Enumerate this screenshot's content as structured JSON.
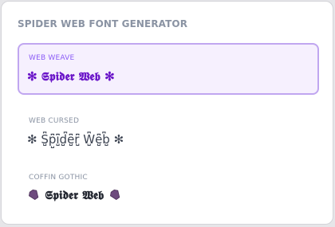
{
  "header": {
    "title": "SPIDER WEB FONT GENERATOR"
  },
  "options": [
    {
      "label": "WEB WEAVE",
      "preview": "✻ 𝕾𝖕𝖎𝖉𝖊𝖗 𝖂𝖊𝖇 ✻",
      "selected": true
    },
    {
      "label": "WEB CURSED",
      "preview": "✻ S̺͆p̺͆i̺͆d̺͆e̺͆r̺͆ W̺͆e̺͆b̺͆ ✻",
      "selected": false
    },
    {
      "label": "COFFIN GOTHIC",
      "preview_text": "𝕾𝖕𝖎𝖉𝖊𝖗 𝖂𝖊𝖇",
      "icon": "coffin-icon",
      "selected": false
    }
  ],
  "colors": {
    "accent": "#8b5cf6",
    "selected_text": "#6b16c9",
    "selected_bg": "#f6f0fe",
    "selected_border": "#c0a6f0",
    "muted": "#8a93a3"
  }
}
